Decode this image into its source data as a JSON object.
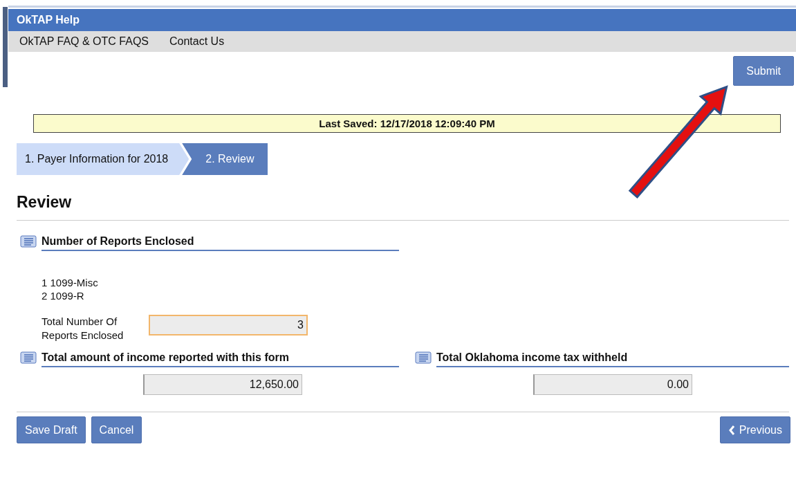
{
  "header": {
    "title": "OkTAP Help"
  },
  "menu": [
    "OkTAP FAQ & OTC FAQS",
    "Contact Us"
  ],
  "submit_button": "Submit",
  "last_saved": "Last Saved: 12/17/2018 12:09:40 PM",
  "steps": [
    {
      "label": "1. Payer Information for 2018",
      "selected": false
    },
    {
      "label": "2. Review",
      "selected": true
    }
  ],
  "page_title": "Review",
  "reports_section": {
    "title": "Number of Reports Enclosed",
    "items": [
      "1 1099-Misc",
      "2 1099-R"
    ],
    "total_label": "Total Number Of Reports Enclosed",
    "total_value": "3",
    "focused": true
  },
  "amount_sections": [
    {
      "title": "Total amount of income reported with this form",
      "value": "12,650.00",
      "focused": false
    },
    {
      "title": "Total Oklahoma income tax withheld",
      "value": "0.00",
      "focused": false
    }
  ],
  "footer_buttons": {
    "left": [
      "Save Draft",
      "Cancel"
    ],
    "previous": "Previous"
  }
}
